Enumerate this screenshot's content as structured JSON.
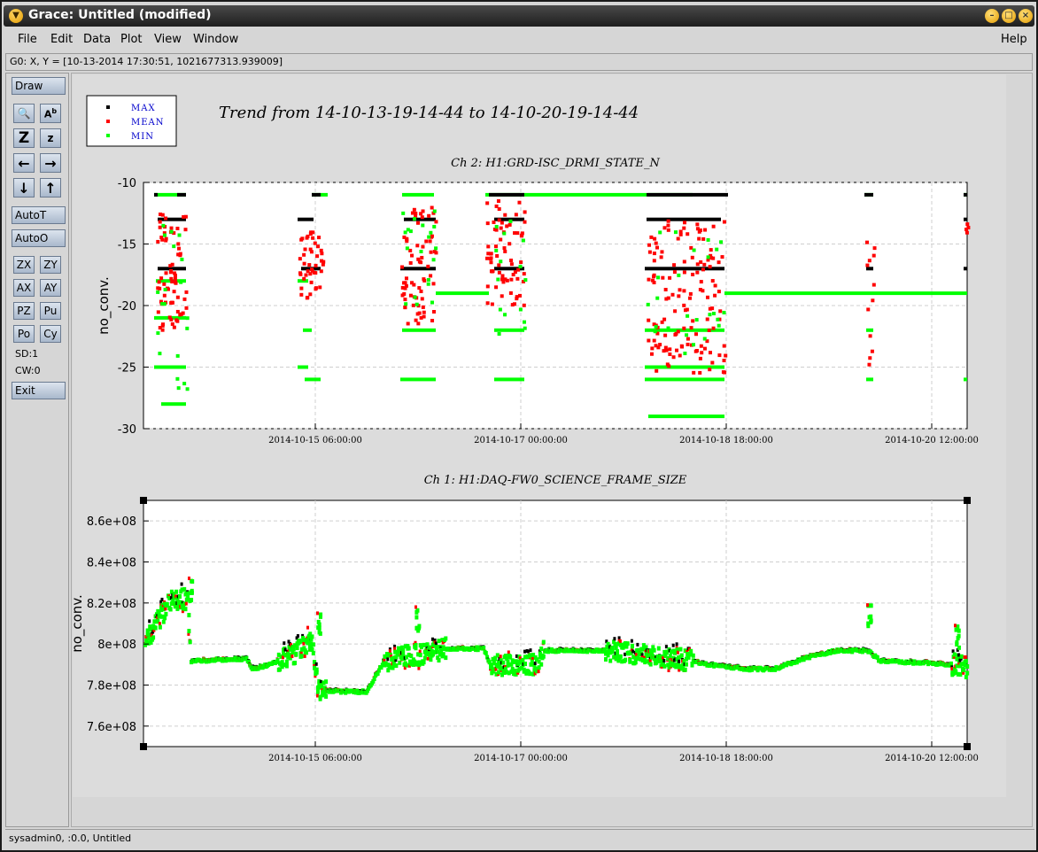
{
  "window": {
    "title": "Grace: Untitled (modified)"
  },
  "menus": [
    "File",
    "Edit",
    "Data",
    "Plot",
    "View",
    "Window"
  ],
  "help": "Help",
  "locator": "G0: X, Y = [10-13-2014 17:30:51, 1021677313.939009]",
  "toolbar": {
    "draw": "Draw",
    "autot": "AutoT",
    "autoo": "AutoO",
    "grid": [
      "ZX",
      "ZY",
      "AX",
      "AY",
      "PZ",
      "Pu",
      "Po",
      "Cy"
    ],
    "sd": "SD:1",
    "cw": "CW:0",
    "exit": "Exit"
  },
  "status": "sysadmin0, :0.0, Untitled",
  "colors": {
    "max": "#000000",
    "mean": "#ff0000",
    "min": "#00ff00"
  },
  "chart_data": [
    {
      "type": "scatter",
      "title": "Trend from 14-10-13-19-14-44 to 14-10-20-19-14-44",
      "subtitle": "Ch 2: H1:GRD-ISC_DRMI_STATE_N",
      "ylabel": "no_conv.",
      "ylim": [
        -30,
        -10
      ],
      "yticks": [
        -10,
        -15,
        -20,
        -25,
        -30
      ],
      "xticks": [
        "2014-10-15 06:00:00",
        "2014-10-17 00:00:00",
        "2014-10-18 18:00:00",
        "2014-10-20 12:00:00"
      ],
      "legend": [
        "MAX",
        "MEAN",
        "MIN"
      ],
      "legend_placement": "top-left",
      "grid": true
    },
    {
      "type": "scatter",
      "subtitle": "Ch 1: H1:DAQ-FW0_SCIENCE_FRAME_SIZE",
      "ylabel": "no_conv.",
      "ylim": [
        750000000.0,
        870000000.0
      ],
      "yticks": [
        "8.6e+08",
        "8.4e+08",
        "8.2e+08",
        "8e+08",
        "7.8e+08",
        "7.6e+08"
      ],
      "xticks": [
        "2014-10-15 06:00:00",
        "2014-10-17 00:00:00",
        "2014-10-18 18:00:00",
        "2014-10-20 12:00:00"
      ],
      "grid": true
    }
  ]
}
